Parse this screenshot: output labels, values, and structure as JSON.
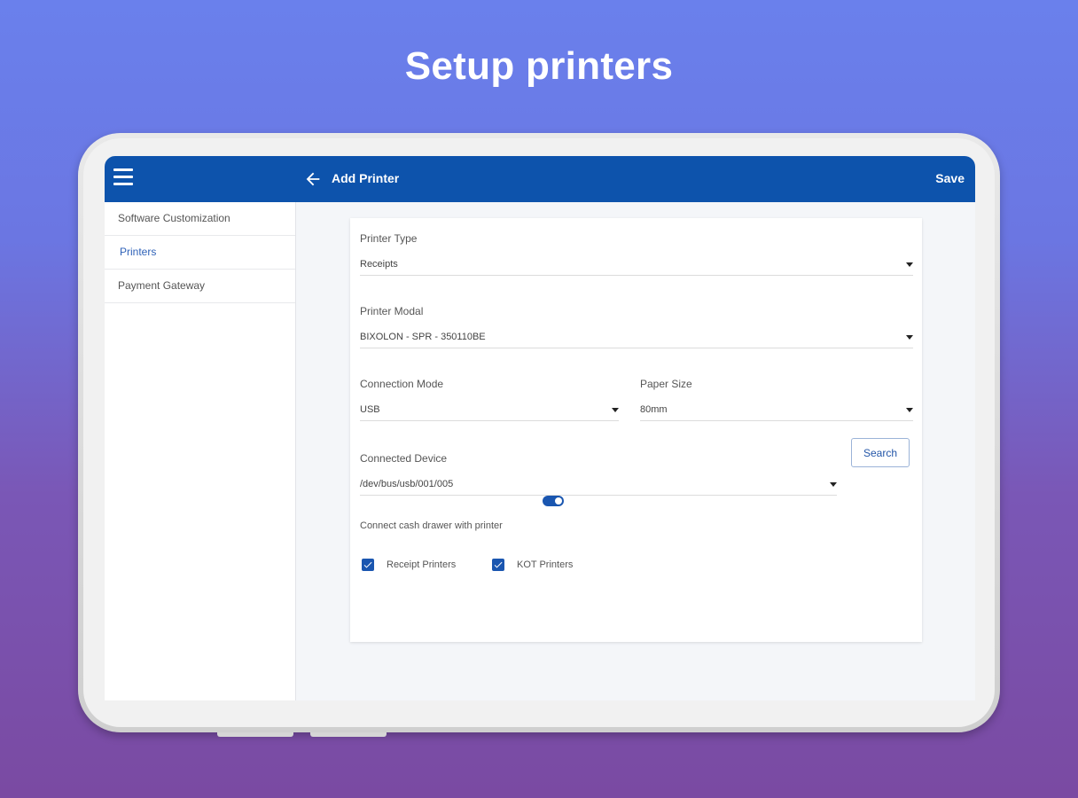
{
  "headline": "Setup printers",
  "appbar": {
    "title": "Add Printer",
    "save_label": "Save"
  },
  "sidebar": {
    "items": [
      {
        "label": "Software Customization",
        "active": false
      },
      {
        "label": "Printers",
        "active": true
      },
      {
        "label": "Payment Gateway",
        "active": false
      }
    ]
  },
  "form": {
    "printer_type": {
      "label": "Printer Type",
      "value": "Receipts"
    },
    "printer_modal": {
      "label": "Printer Modal",
      "value": "BIXOLON - SPR - 350110BE"
    },
    "connection_mode": {
      "label": "Connection Mode",
      "value": "USB"
    },
    "paper_size": {
      "label": "Paper Size",
      "value": "80mm"
    },
    "connected_device": {
      "label": "Connected Device",
      "value": "/dev/bus/usb/001/005"
    },
    "search_label": "Search",
    "cash_drawer": {
      "label": "Connect cash drawer with printer",
      "enabled": true
    },
    "checkboxes": [
      {
        "label": "Receipt Printers",
        "checked": true
      },
      {
        "label": "KOT Printers",
        "checked": true
      }
    ]
  },
  "colors": {
    "appbar": "#0d53ac",
    "accent": "#1a56b0",
    "active_nav": "#2f62b8"
  }
}
